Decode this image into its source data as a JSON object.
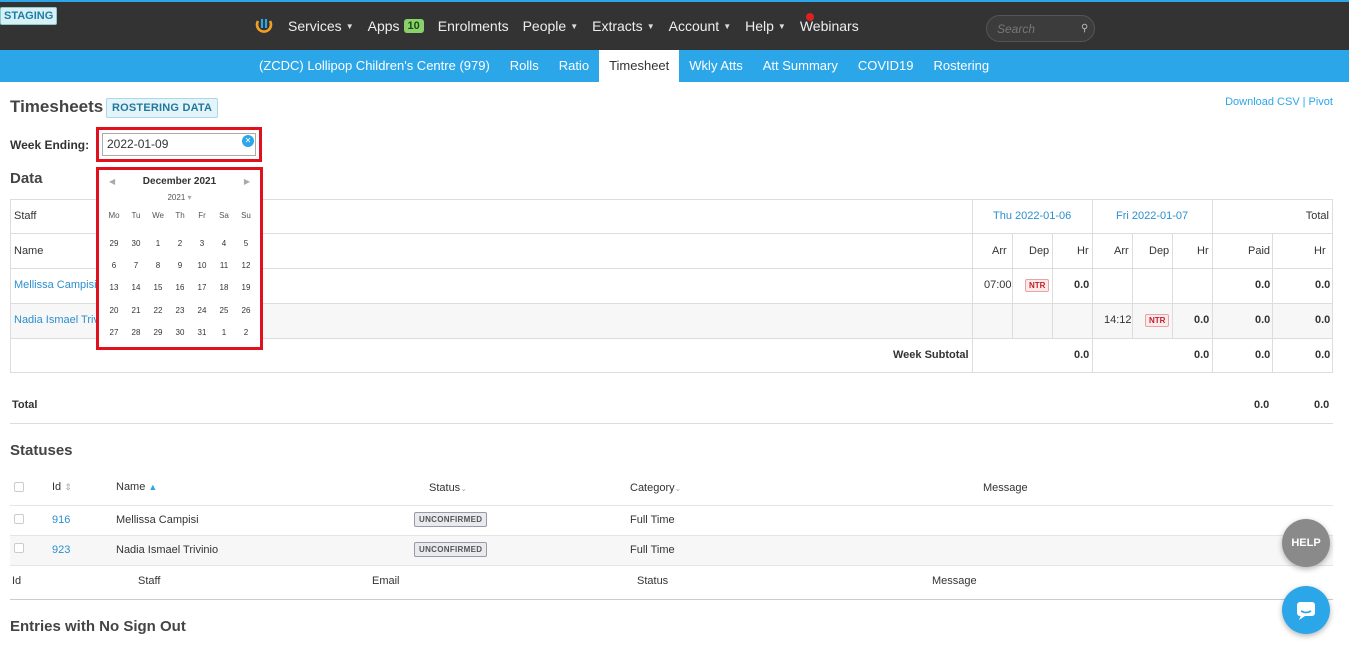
{
  "env_badge": "STAGING",
  "nav": {
    "items": [
      {
        "label": "Services",
        "caret": true
      },
      {
        "label": "Apps",
        "badge": "10"
      },
      {
        "label": "Enrolments"
      },
      {
        "label": "People",
        "caret": true
      },
      {
        "label": "Extracts",
        "caret": true
      },
      {
        "label": "Account",
        "caret": true
      },
      {
        "label": "Help",
        "caret": true
      },
      {
        "label": "Webinars"
      }
    ],
    "search_placeholder": "Search"
  },
  "subnav": {
    "items": [
      "(ZCDC) Lollipop Children's Centre (979)",
      "Rolls",
      "Ratio",
      "Timesheet",
      "Wkly Atts",
      "Att Summary",
      "COVID19",
      "Rostering"
    ],
    "active": "Timesheet"
  },
  "page": {
    "title": "Timesheets",
    "rostering_button": "ROSTERING DATA",
    "download_csv": "Download CSV",
    "pivot": "Pivot",
    "week_ending_label": "Week Ending:",
    "week_ending_value": "2022-01-09"
  },
  "calendar": {
    "month": "December 2021",
    "year": "2021",
    "dow": [
      "Mo",
      "Tu",
      "We",
      "Th",
      "Fr",
      "Sa",
      "Su"
    ],
    "weeks": [
      [
        "29",
        "30",
        "1",
        "2",
        "3",
        "4",
        "5"
      ],
      [
        "6",
        "7",
        "8",
        "9",
        "10",
        "11",
        "12"
      ],
      [
        "13",
        "14",
        "15",
        "16",
        "17",
        "18",
        "19"
      ],
      [
        "20",
        "21",
        "22",
        "23",
        "24",
        "25",
        "26"
      ],
      [
        "27",
        "28",
        "29",
        "30",
        "31",
        "1",
        "2"
      ]
    ]
  },
  "data_section": {
    "heading": "Data",
    "staff_header": "Staff",
    "name_header": "Name",
    "days": [
      "Thu 2022-01-06",
      "Fri 2022-01-07"
    ],
    "total_header": "Total",
    "sub_headers": {
      "arr": "Arr",
      "dep": "Dep",
      "hr": "Hr",
      "paid": "Paid"
    },
    "rows": [
      {
        "name": "Mellissa Campisi",
        "thu_arr": "07:00",
        "thu_dep": "NTR",
        "thu_hr": "0.0",
        "fri_arr": "",
        "fri_dep": "",
        "fri_hr": "",
        "paid": "0.0",
        "hr": "0.0"
      },
      {
        "name": "Nadia Ismael Trivinio",
        "thu_arr": "",
        "thu_dep": "",
        "thu_hr": "",
        "fri_arr": "14:12",
        "fri_dep": "NTR",
        "fri_hr": "0.0",
        "paid": "0.0",
        "hr": "0.0"
      }
    ],
    "subtotal_label": "Week Subtotal",
    "subtotal": {
      "thu_hr": "0.0",
      "fri_hr": "0.0",
      "paid": "0.0",
      "hr": "0.0"
    },
    "total_label": "Total",
    "total": {
      "paid": "0.0",
      "hr": "0.0"
    }
  },
  "statuses": {
    "heading": "Statuses",
    "headers": {
      "id": "Id",
      "name": "Name",
      "status": "Status",
      "category": "Category",
      "message": "Message"
    },
    "rows": [
      {
        "id": "916",
        "name": "Mellissa Campisi",
        "status": "UNCONFIRMED",
        "category": "Full Time",
        "message": ""
      },
      {
        "id": "923",
        "name": "Nadia Ismael Trivinio",
        "status": "UNCONFIRMED",
        "category": "Full Time",
        "message": ""
      }
    ],
    "footer_headers": {
      "id": "Id",
      "staff": "Staff",
      "email": "Email",
      "status": "Status",
      "message": "Message"
    }
  },
  "no_signout_heading": "Entries with No Sign Out",
  "help_label": "HELP",
  "colors": {
    "accent": "#2ba6e8",
    "topbar": "#333333",
    "highlight": "#e0101c"
  }
}
